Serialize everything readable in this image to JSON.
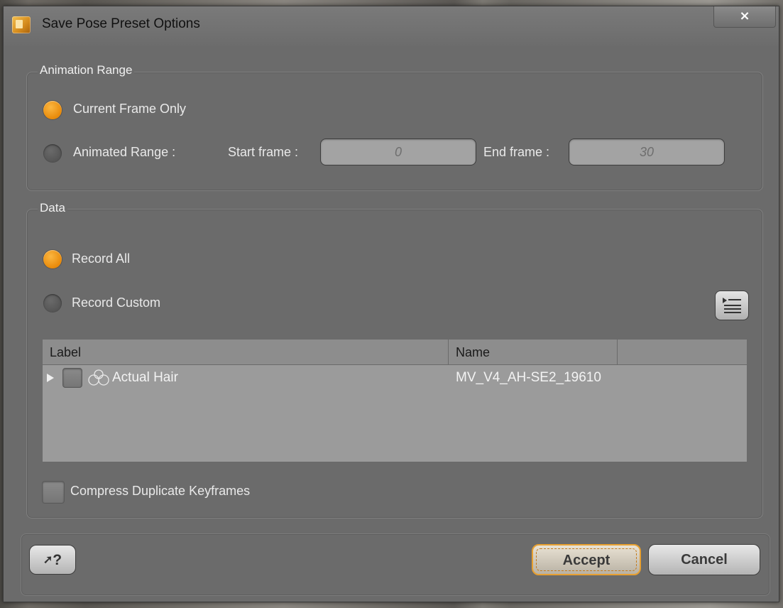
{
  "window": {
    "title": "Save Pose Preset Options",
    "close_label": "×"
  },
  "animation_range": {
    "title": "Animation Range",
    "current_frame_label": "Current Frame Only",
    "animated_range_label": "Animated Range :",
    "start_frame_label": "Start frame :",
    "start_frame_value": "0",
    "end_frame_label": "End frame :",
    "end_frame_value": "30",
    "selected": "current_frame_only"
  },
  "data": {
    "title": "Data",
    "record_all_label": "Record All",
    "record_custom_label": "Record Custom",
    "selected": "record_all",
    "table": {
      "columns": [
        "Label",
        "Name"
      ],
      "rows": [
        {
          "label": "Actual Hair",
          "name": "MV_V4_AH-SE2_19610",
          "expand_icon": "triangle-right-icon",
          "node_icon": "hair-figure-icon"
        }
      ]
    },
    "compress_label": "Compress Duplicate Keyframes"
  },
  "footer": {
    "help_label": "?",
    "accept_label": "Accept",
    "cancel_label": "Cancel"
  },
  "colors": {
    "accent": "#f0a020",
    "dialog_bg": "#6b6b6b"
  }
}
